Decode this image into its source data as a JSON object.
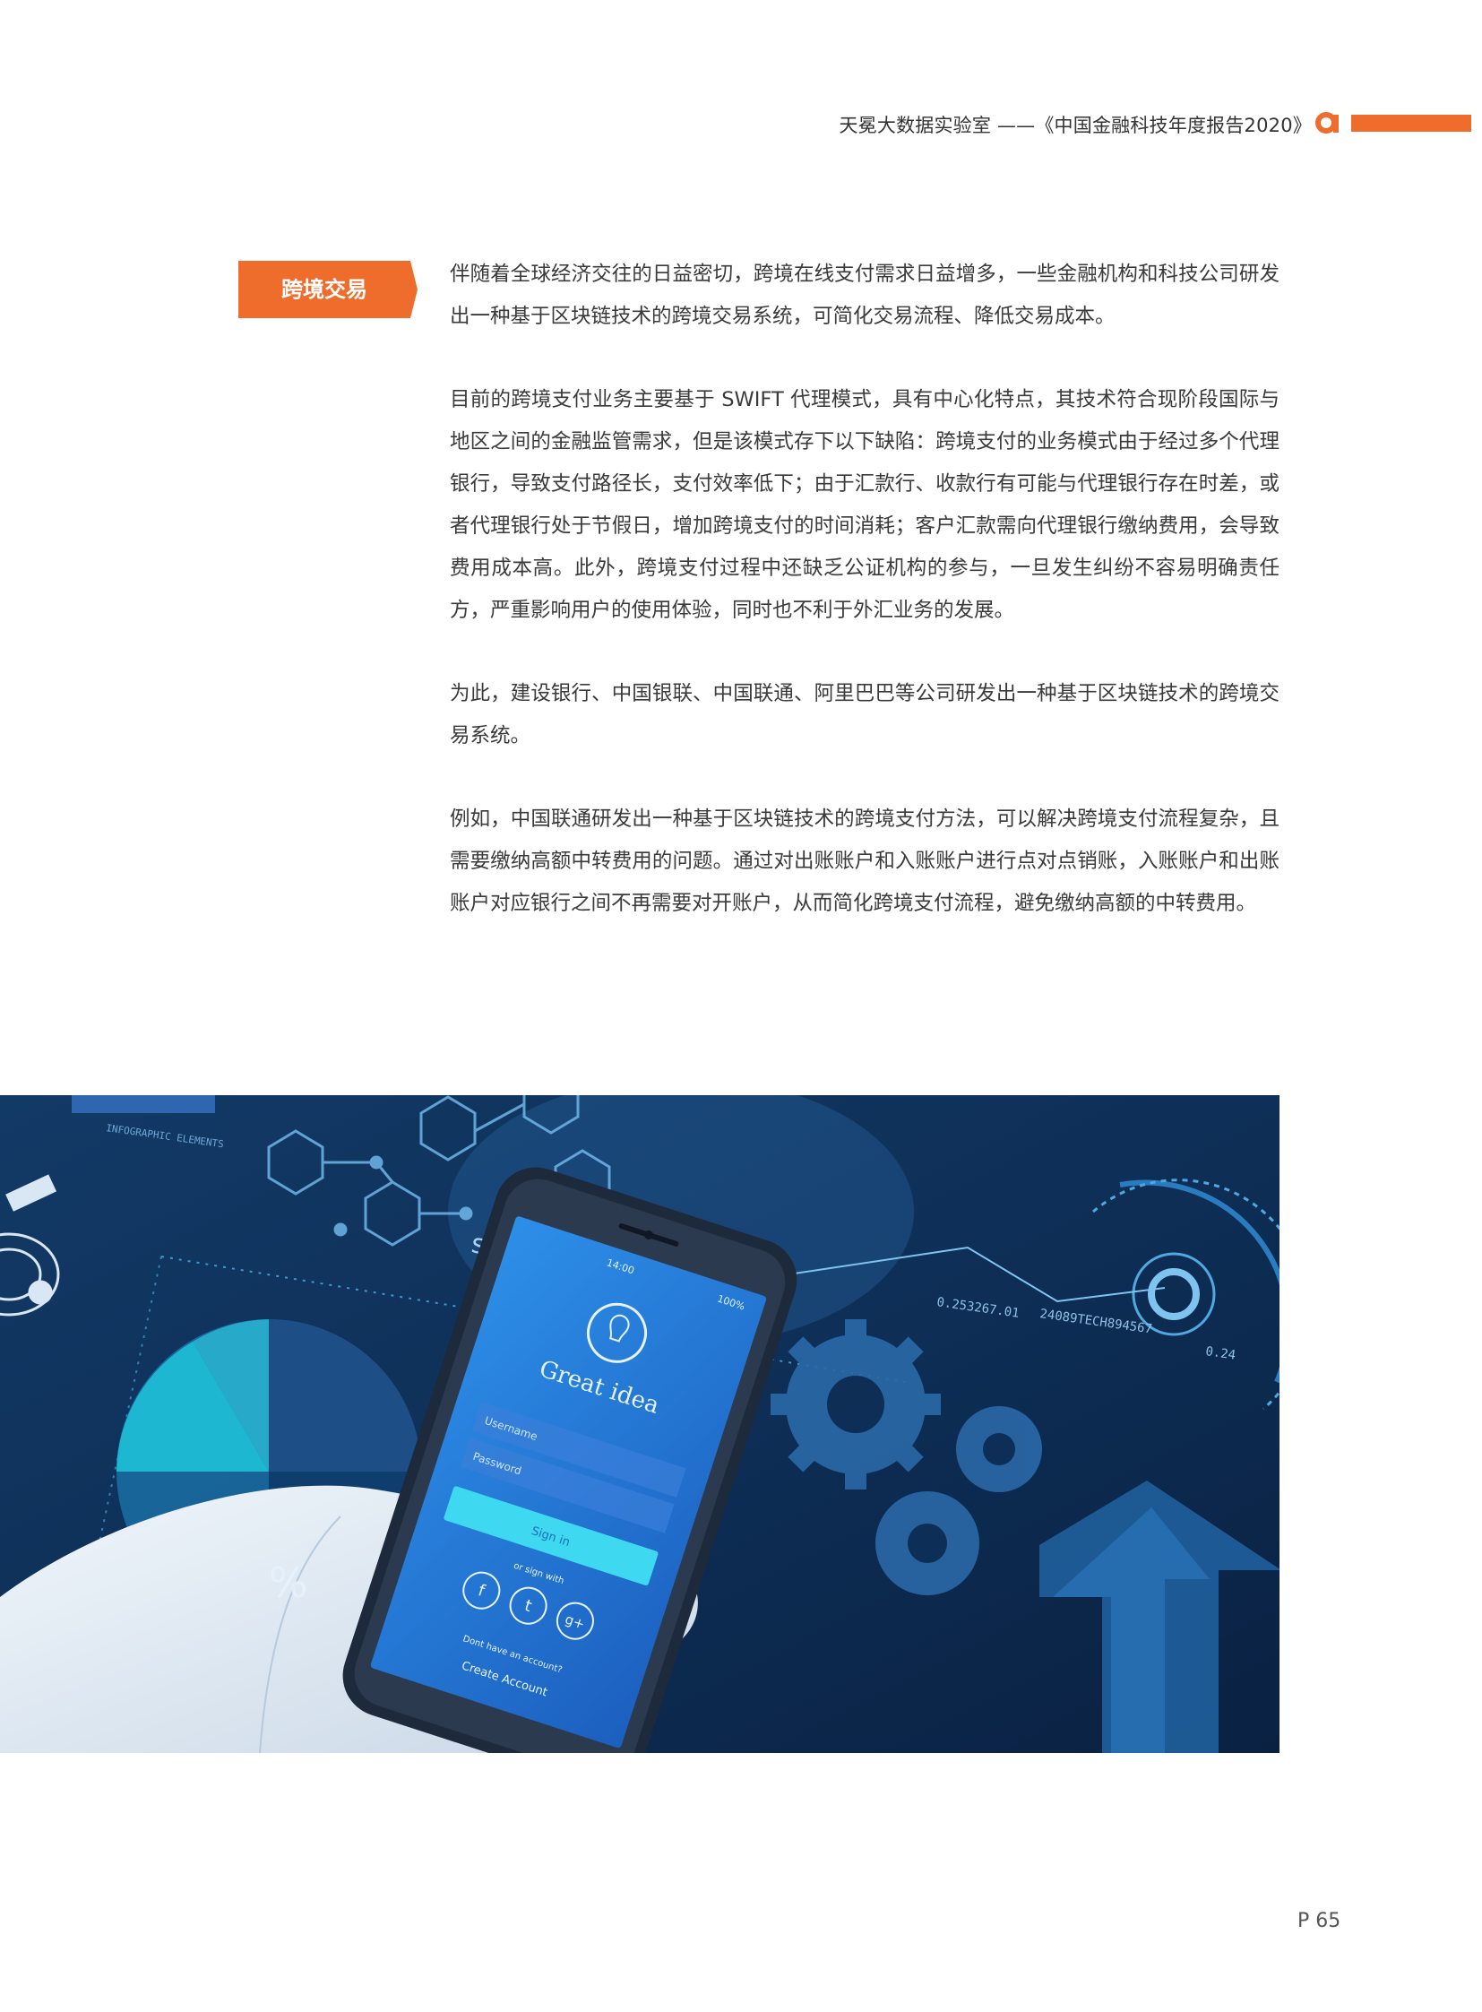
{
  "header": {
    "title": "天冕大数据实验室 ——《中国金融科技年度报告2020》",
    "accent_color": "#ee6c2c",
    "logo_icon": "stylized-a-logo"
  },
  "section": {
    "tag": "跨境交易",
    "paragraphs": [
      "伴随着全球经济交往的日益密切，跨境在线支付需求日益增多，一些金融机构和科技公司研发出一种基于区块链技术的跨境交易系统，可简化交易流程、降低交易成本。",
      "目前的跨境支付业务主要基于 SWIFT 代理模式，具有中心化特点，其技术符合现阶段国际与地区之间的金融监管需求，但是该模式存下以下缺陷：跨境支付的业务模式由于经过多个代理银行，导致支付路径长，支付效率低下；由于汇款行、收款行有可能与代理银行存在时差，或者代理银行处于节假日，增加跨境支付的时间消耗；客户汇款需向代理银行缴纳费用，会导致费用成本高。此外，跨境支付过程中还缺乏公证机构的参与，一旦发生纠纷不容易明确责任方，严重影响用户的使用体验，同时也不利于外汇业务的发展。",
      "为此，建设银行、中国银联、中国联通、阿里巴巴等公司研发出一种基于区块链技术的跨境交易系统。",
      "例如，中国联通研发出一种基于区块链技术的跨境支付方法，可以解决跨境支付流程复杂，且需要缴纳高额中转费用的问题。通过对出账账户和入账账户进行点对点销账，入账账户和出账账户对应银行之间不再需要对开账户，从而简化跨境支付流程，避免缴纳高额的中转费用。"
    ]
  },
  "figure": {
    "overlay_texts": {
      "success": "success",
      "time": "14:00",
      "battery": "100%",
      "app_title": "Great idea",
      "username": "Username",
      "password": "Password",
      "sign_in": "Sign in",
      "or_sign_with": "or sign with",
      "no_account": "Dont have an account?",
      "create_account": "Create Account",
      "percent": "%",
      "number_1": "0.253267.01",
      "number_2": "24089TECH894567",
      "number_3": "0.24",
      "infographic": "INFOGRAPHIC ELEMENTS"
    },
    "icons": [
      "lightbulb-icon",
      "facebook-icon",
      "twitter-icon",
      "google-plus-icon",
      "gear-icon",
      "up-arrow-icon"
    ]
  },
  "footer": {
    "page_number": "P 65"
  }
}
